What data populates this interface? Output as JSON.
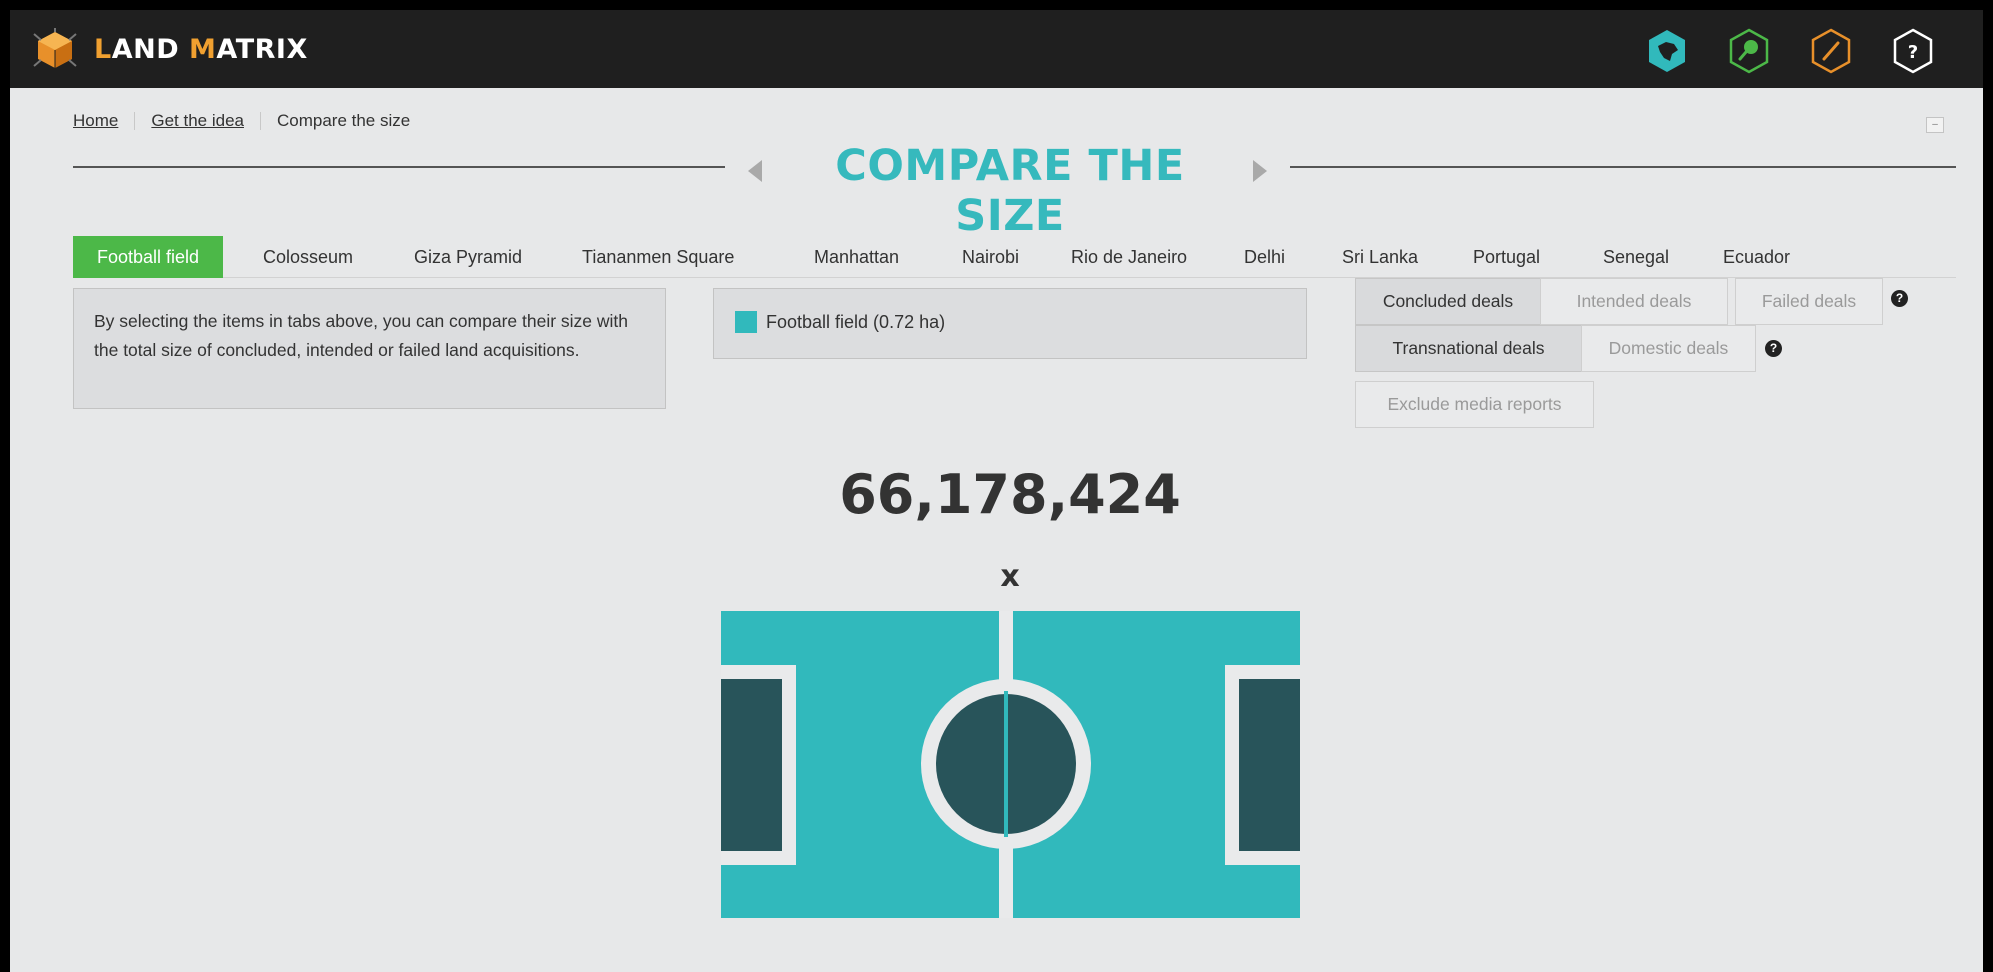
{
  "header": {
    "brand_first": "L",
    "brand_rest1": "AND ",
    "brand_highlight": "M",
    "brand_rest2": "ATRIX",
    "nav_icons": [
      "map-icon",
      "search-icon",
      "edit-icon",
      "help-icon"
    ],
    "help_symbol": "?"
  },
  "breadcrumb": {
    "items": [
      "Home",
      "Get the idea",
      "Compare the size"
    ]
  },
  "title": "COMPARE THE SIZE",
  "tabs": [
    "Football field",
    "Colosseum",
    "Giza Pyramid",
    "Tiananmen Square",
    "Manhattan",
    "Nairobi",
    "Rio de Janeiro",
    "Delhi",
    "Sri Lanka",
    "Portugal",
    "Senegal",
    "Ecuador"
  ],
  "active_tab": "Football field",
  "info_text": "By selecting the items in tabs above, you can compare their size with the total size of concluded, intended or failed land acquisitions.",
  "legend": {
    "label": "Football field (0.72 ha)",
    "color": "#31b9bc"
  },
  "filters": {
    "deal_status": [
      {
        "label": "Concluded deals",
        "active": true
      },
      {
        "label": "Intended deals",
        "active": false
      },
      {
        "label": "Failed deals",
        "active": false
      }
    ],
    "deal_scope": [
      {
        "label": "Transnational deals",
        "active": true
      },
      {
        "label": "Domestic deals",
        "active": false
      }
    ],
    "media": {
      "label": "Exclude media reports",
      "active": false
    },
    "help_symbol": "?"
  },
  "result": {
    "count": "66,178,424",
    "times": "x"
  },
  "colors": {
    "accent_teal": "#36b9bd",
    "tab_active_green": "#4cb848",
    "highlight_orange": "#f0a030",
    "field_dark": "#28545a"
  }
}
